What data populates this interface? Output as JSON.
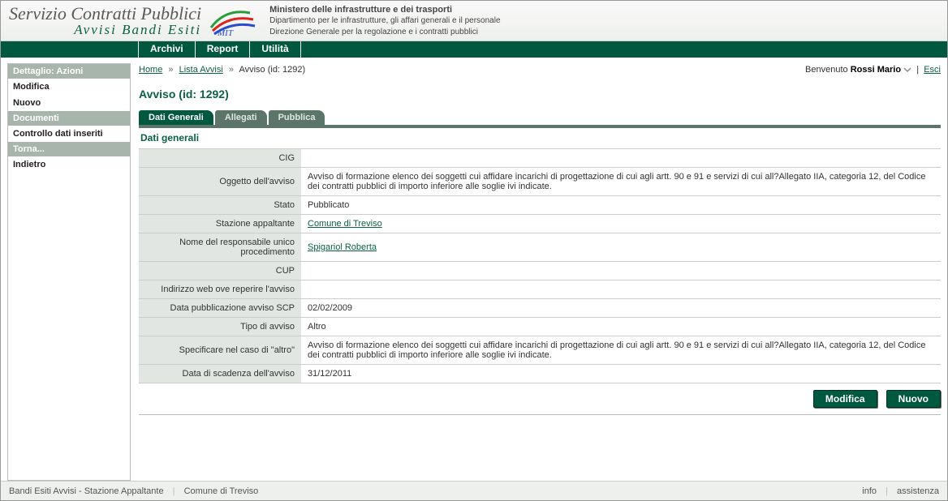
{
  "header": {
    "title_line1": "Servizio Contratti Pubblici",
    "title_line2": "Avvisi Bandi Esiti",
    "ministero_bold": "Ministero delle infrastrutture e dei trasporti",
    "ministero_line2": "Dipartimento per le infrastrutture, gli affari generali e il personale",
    "ministero_line3": "Direzione Generale per la regolazione e i contratti pubblici"
  },
  "nav": {
    "archivi": "Archivi",
    "report": "Report",
    "utilita": "Utilità"
  },
  "sidebar": {
    "sec1_title": "Dettaglio: Azioni",
    "sec1_items": {
      "modifica": "Modifica",
      "nuovo": "Nuovo"
    },
    "sec2_title": "Documenti",
    "sec2_items": {
      "controllo": "Controllo dati inseriti"
    },
    "sec3_title": "Torna...",
    "sec3_items": {
      "indietro": "Indietro"
    }
  },
  "breadcrumb": {
    "home": "Home",
    "lista": "Lista Avvisi",
    "current": "Avviso (id: 1292)"
  },
  "user": {
    "welcome": "Benvenuto",
    "name": "Rossi Mario",
    "exit": "Esci"
  },
  "page_title": "Avviso (id: 1292)",
  "tabs": {
    "dati": "Dati Generali",
    "allegati": "Allegati",
    "pubblica": "Pubblica"
  },
  "section_title": "Dati generali",
  "rows": {
    "cig_label": "CIG",
    "cig_value": "",
    "oggetto_label": "Oggetto dell'avviso",
    "oggetto_value": "Avviso di formazione elenco dei soggetti cui affidare incarichi di progettazione di cui agli artt. 90 e 91 e servizi di cui all?Allegato IIA, categoria 12, del Codice dei contratti pubblici di importo inferiore alle soglie ivi indicate.",
    "stato_label": "Stato",
    "stato_value": "Pubblicato",
    "stazione_label": "Stazione appaltante",
    "stazione_value": "Comune di Treviso",
    "responsabile_label": "Nome del responsabile unico procedimento",
    "responsabile_value": "Spigariol Roberta",
    "cup_label": "CUP",
    "cup_value": "",
    "indirizzo_label": "Indirizzo web ove reperire l'avviso",
    "indirizzo_value": "",
    "datapub_label": "Data pubblicazione avviso SCP",
    "datapub_value": "02/02/2009",
    "tipo_label": "Tipo di avviso",
    "tipo_value": "Altro",
    "spec_label": "Specificare nel caso di \"altro\"",
    "spec_value": "Avviso di formazione elenco dei soggetti cui affidare incarichi di progettazione di cui agli artt. 90 e 91 e servizi di cui all?Allegato IIA, categoria 12, del Codice dei contratti pubblici di importo inferiore alle soglie ivi indicate.",
    "scad_label": "Data di scadenza dell'avviso",
    "scad_value": "31/12/2011"
  },
  "buttons": {
    "modifica": "Modifica",
    "nuovo": "Nuovo"
  },
  "footer": {
    "left1": "Bandi Esiti Avvisi - Stazione Appaltante",
    "left2": "Comune di Treviso",
    "info": "info",
    "assistenza": "assistenza"
  }
}
